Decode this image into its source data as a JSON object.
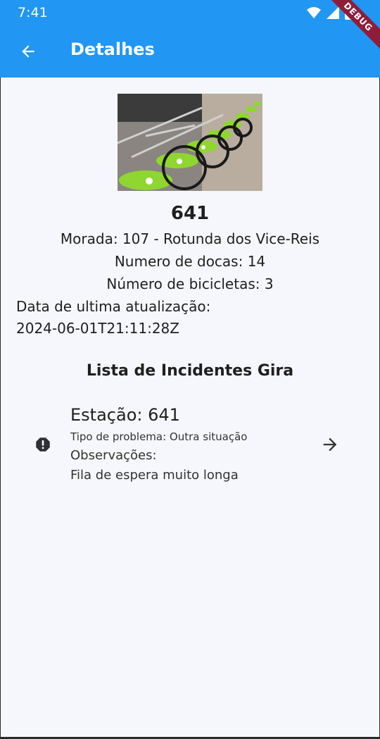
{
  "status_bar": {
    "time": "7:41",
    "debug_label": "DEBUG"
  },
  "app_bar": {
    "title": "Detalhes",
    "back_icon": "arrow-back-icon"
  },
  "station": {
    "id": "641",
    "address": "Morada: 107 - Rotunda dos Vice-Reis",
    "docks": "Numero de docas: 14",
    "bikes": "Número de bicicletas: 3",
    "updated_label": "Data de ultima atualização:",
    "updated_value": "2024-06-01T21:11:28Z"
  },
  "incidents": {
    "section_title": "Lista de Incidentes Gira",
    "items": [
      {
        "title": "Estação: 641",
        "type": "Tipo de problema: Outra situação",
        "obs_label": "Observações:",
        "obs_text": "Fila de espera muito longa",
        "icon": "error-icon",
        "action_icon": "arrow-forward-icon"
      }
    ]
  },
  "colors": {
    "primary": "#2196f3",
    "background": "#f6f7fc",
    "bike_green": "#8fd630"
  }
}
